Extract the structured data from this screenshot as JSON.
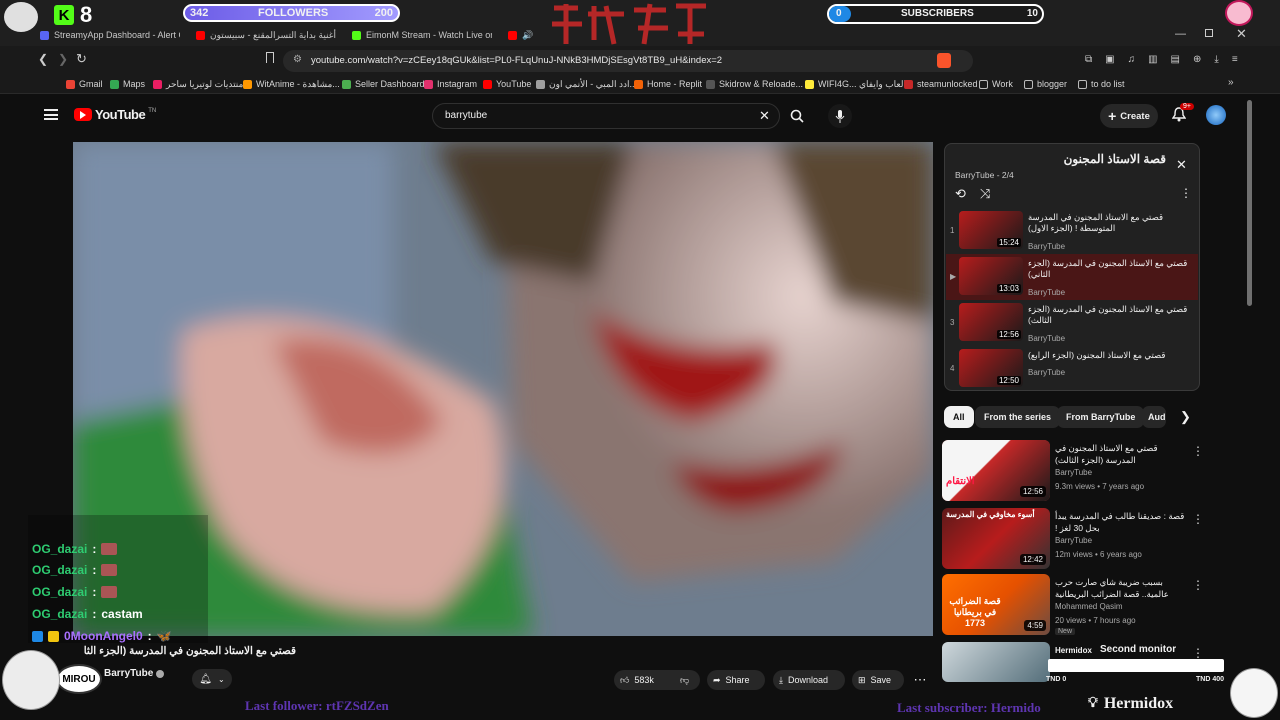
{
  "tabs": [
    {
      "label": "StreamyApp Dashboard - Alert Confi",
      "color": "#5865f2"
    },
    {
      "label": "أغنية بداية التسرالمقنع - سبيستون",
      "color": "#ff0000"
    },
    {
      "label": "EimonM Stream - Watch Live on",
      "color": "#53fc18"
    },
    {
      "label": "",
      "color": "#ff0000"
    }
  ],
  "address": {
    "url": "youtube.com/watch?v=zCEey18qGUk&list=PL0-FLqUnuJ-NNkB3HMDjSEsgVt8TB9_uH&index=2"
  },
  "bookmarks": [
    {
      "label": "Gmail",
      "color": "#ea4335"
    },
    {
      "label": "Maps",
      "color": "#34a853"
    },
    {
      "label": "منتديات لوتيريا ساحر",
      "color": "#e91e63"
    },
    {
      "label": "WitAnime - مشاهدة...",
      "color": "#ff9800"
    },
    {
      "label": "Seller Dashboard",
      "color": "#4caf50"
    },
    {
      "label": "Instagram",
      "color": "#e1306c"
    },
    {
      "label": "YouTube",
      "color": "#ff0000"
    },
    {
      "label": "ادد المبي - الأنمي اون...",
      "color": "#9e9e9e"
    },
    {
      "label": "Home - Replit",
      "color": "#f26207"
    },
    {
      "label": "Skidrow & Reloade...",
      "color": "#555555"
    },
    {
      "label": "WIFI4G... العاب وايفاي",
      "color": "#ffeb3b"
    },
    {
      "label": "steamunlocked",
      "color": "#c62828"
    },
    {
      "label": "Work",
      "color": "#bbbbbb"
    },
    {
      "label": "blogger",
      "color": "#bbbbbb"
    },
    {
      "label": "to do list",
      "color": "#bbbbbb"
    }
  ],
  "overlay": {
    "kick_count": "8",
    "followers_left": "342",
    "followers_label": "FOLLOWERS",
    "followers_right": "200",
    "subs_left": "0",
    "subs_label": "SUBSCRIBERS",
    "subs_right": "10",
    "last_follower": "Last follower: rtFZSdZen",
    "last_subscriber": "Last subscriber: Hermido",
    "streamer": "Hermidox",
    "second_monitor": "Second monitor",
    "second_monitor_left": "TND 0",
    "second_monitor_right": "TND 400",
    "logo_text": "MIROU"
  },
  "chat": [
    {
      "user": "OG_dazai",
      "msg": "",
      "user_color": "#2ecc71"
    },
    {
      "user": "OG_dazai",
      "msg": "",
      "user_color": "#2ecc71"
    },
    {
      "user": "OG_dazai",
      "msg": "",
      "user_color": "#2ecc71"
    },
    {
      "user": "OG_dazai",
      "msg": "castam",
      "user_color": "#2ecc71"
    },
    {
      "user": "0MoonAngel0",
      "msg": "",
      "user_color": "#a970ff"
    }
  ],
  "yt": {
    "logo": "YouTube",
    "logo_sup": "TN",
    "search_value": "barrytube",
    "create": "Create",
    "notif_badge": "9+"
  },
  "video": {
    "title": "قصتي مع الاستاذ المجنون في المدرسة (الجزء الثاني)",
    "channel": "BarryTube",
    "likes": "583k",
    "share": "Share",
    "download": "Download",
    "save": "Save"
  },
  "playlist": {
    "title": "قصة الاستاذ المجنون",
    "subtitle": "BarryTube - 2/4",
    "items": [
      {
        "num": "1",
        "title": "قصتي مع الاستاذ المجنون في المدرسة المتوسطة ! (الجزء الاول)",
        "channel": "BarryTube",
        "duration": "15:24",
        "active": false
      },
      {
        "num": "▶",
        "title": "قصتي مع الاستاذ المجنون في المدرسة (الجزء الثاني)",
        "channel": "BarryTube",
        "duration": "13:03",
        "active": true
      },
      {
        "num": "3",
        "title": "قصتي مع الاستاذ المجنون في المدرسة (الجزء الثالث)",
        "channel": "BarryTube",
        "duration": "12:56",
        "active": false
      },
      {
        "num": "4",
        "title": "قصتي مع الاستاذ المجنون (الجزء الرابع)",
        "channel": "BarryTube",
        "duration": "12:50",
        "active": false
      }
    ]
  },
  "chips": [
    "All",
    "From the series",
    "From BarryTube",
    "Aud"
  ],
  "recommendations": [
    {
      "title": "قصتي مع الاستاذ المجنون في المدرسة (الجزء الثالث)",
      "channel": "BarryTube",
      "views": "9.3m views • 7 years ago",
      "duration": "12:56",
      "thumb_text": "الانتقام",
      "color": "#d32f2f"
    },
    {
      "title": "قصة : صديقنا طالب في المدرسة يبدأ بحل 30 لغز !",
      "channel": "BarryTube",
      "views": "12m views • 6 years ago",
      "duration": "12:42",
      "thumb_text": "أسوء مخاوفي في المدرسة",
      "color": "#8e2424"
    },
    {
      "title": "بسبب ضريبة شاي صارت حرب عالمية.. قصة الضرائب البريطانية",
      "channel": "Mohammed Qasim",
      "views": "20 views • 7 hours ago",
      "duration": "4:59",
      "thumb_text": "قصة الضرائب في بريطانيا 1773",
      "color": "#e65100",
      "badge": "New"
    },
    {
      "title": "",
      "channel": "Hermidox",
      "views": "",
      "duration": "",
      "thumb_text": "",
      "color": "#607d8b"
    }
  ]
}
